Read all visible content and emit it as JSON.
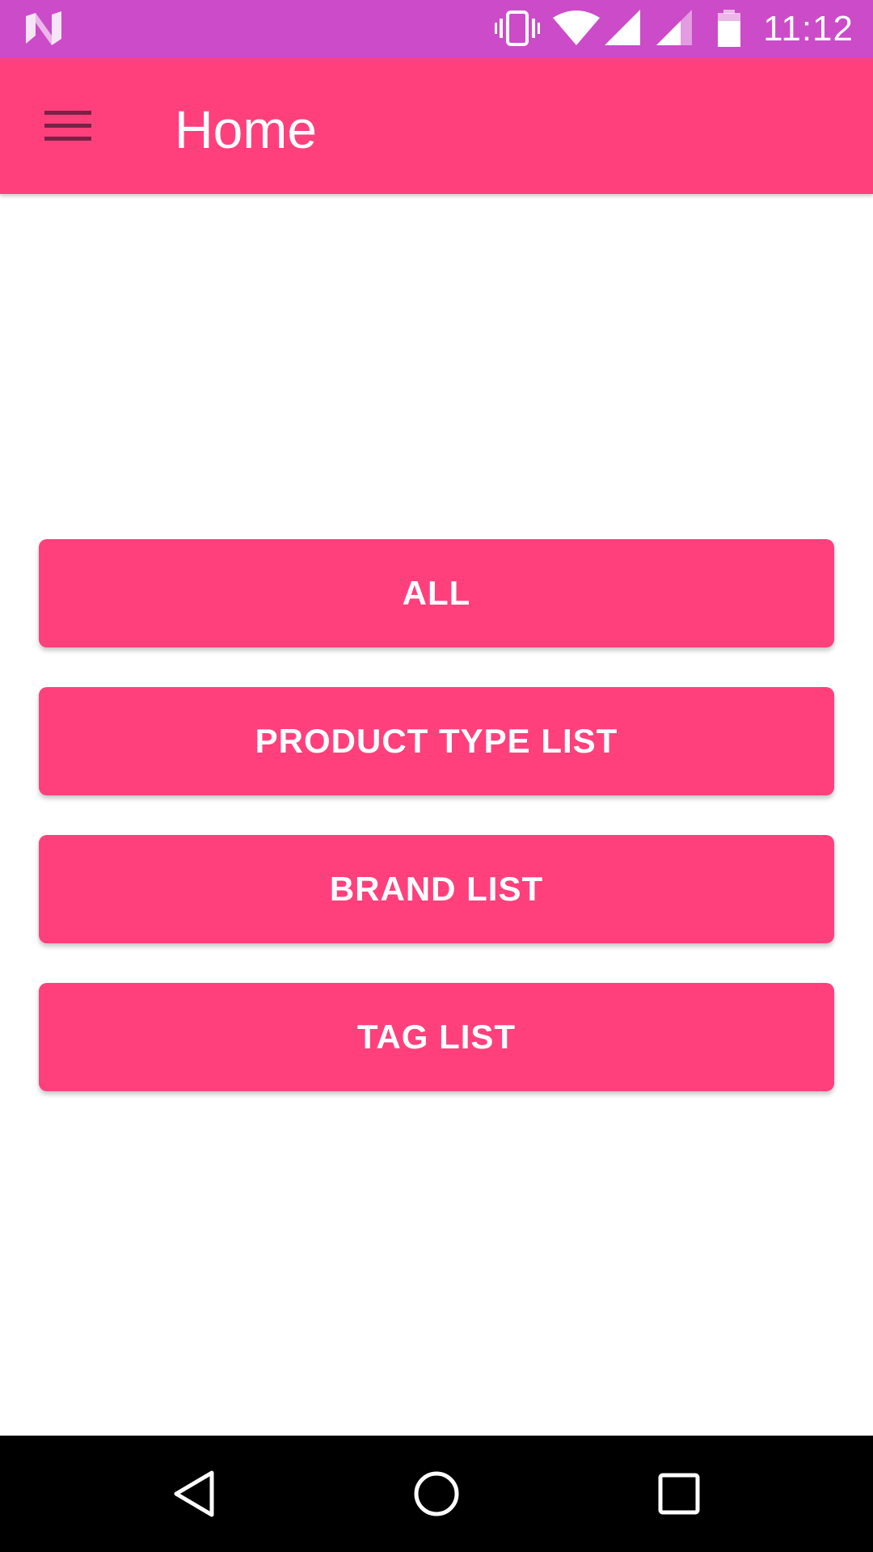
{
  "status_bar": {
    "time": "11:12",
    "icons": [
      "n-logo-icon",
      "vibrate-icon",
      "wifi-icon",
      "signal-icon",
      "signal-icon",
      "battery-icon"
    ],
    "background_color": "#cc4bc8"
  },
  "app_bar": {
    "title": "Home",
    "menu_icon": "menu-icon",
    "background_color": "#ff407d"
  },
  "buttons": [
    {
      "label": "ALL"
    },
    {
      "label": "PRODUCT TYPE LIST"
    },
    {
      "label": "BRAND LIST"
    },
    {
      "label": "TAG LIST"
    }
  ],
  "nav_bar": {
    "icons": [
      "back-icon",
      "home-icon",
      "recents-icon"
    ]
  },
  "colors": {
    "accent": "#ff407d",
    "status": "#cc4bc8",
    "nav": "#000000"
  }
}
